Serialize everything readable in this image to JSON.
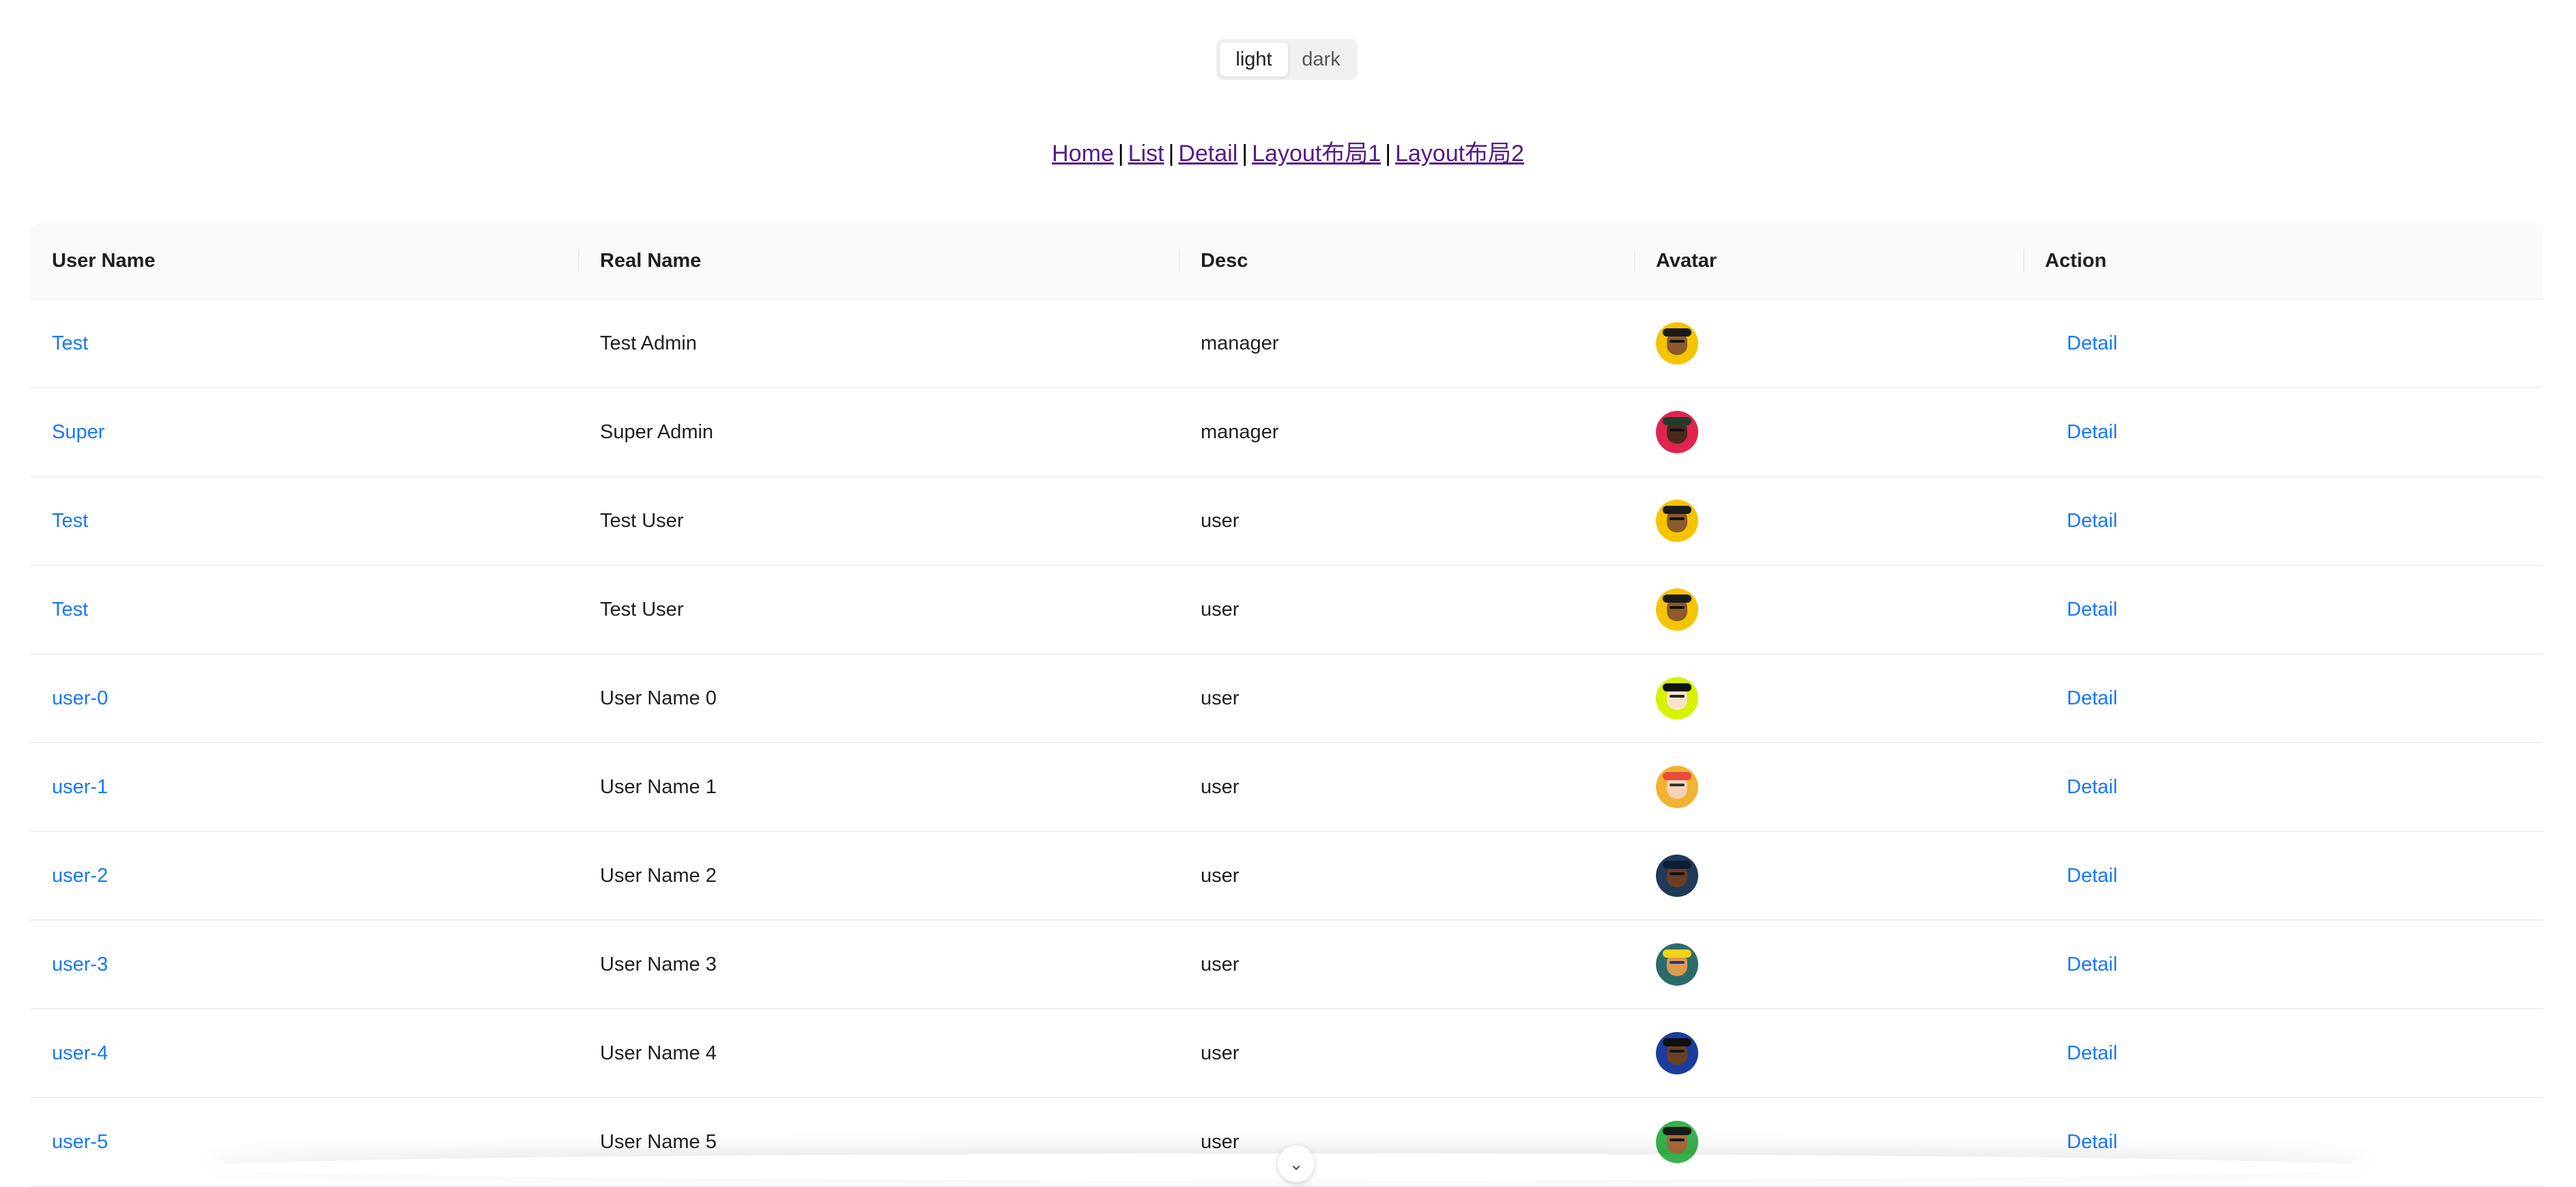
{
  "theme_switch": {
    "light_label": "light",
    "dark_label": "dark",
    "selected": "light"
  },
  "nav": {
    "links": [
      "Home",
      "List",
      "Detail",
      "Layout布局1",
      "Layout布局2"
    ],
    "separator": "|"
  },
  "table": {
    "columns": [
      "User Name",
      "Real Name",
      "Desc",
      "Avatar",
      "Action"
    ],
    "rows": [
      {
        "user_name": "Test",
        "real_name": "Test Admin",
        "desc": "manager",
        "avatar": "avatar-yellow-hat",
        "action": "Detail"
      },
      {
        "user_name": "Super",
        "real_name": "Super Admin",
        "desc": "manager",
        "avatar": "avatar-red",
        "action": "Detail"
      },
      {
        "user_name": "Test",
        "real_name": "Test User",
        "desc": "user",
        "avatar": "avatar-yellow-hat",
        "action": "Detail"
      },
      {
        "user_name": "Test",
        "real_name": "Test User",
        "desc": "user",
        "avatar": "avatar-yellow-hat",
        "action": "Detail"
      },
      {
        "user_name": "user-0",
        "real_name": "User Name 0",
        "desc": "user",
        "avatar": "avatar-lime-afro",
        "action": "Detail"
      },
      {
        "user_name": "user-1",
        "real_name": "User Name 1",
        "desc": "user",
        "avatar": "avatar-orange-crown",
        "action": "Detail"
      },
      {
        "user_name": "user-2",
        "real_name": "User Name 2",
        "desc": "user",
        "avatar": "avatar-navy",
        "action": "Detail"
      },
      {
        "user_name": "user-3",
        "real_name": "User Name 3",
        "desc": "user",
        "avatar": "avatar-teal-crown",
        "action": "Detail"
      },
      {
        "user_name": "user-4",
        "real_name": "User Name 4",
        "desc": "user",
        "avatar": "avatar-blue-beard",
        "action": "Detail"
      },
      {
        "user_name": "user-5",
        "real_name": "User Name 5",
        "desc": "user",
        "avatar": "avatar-green-cap",
        "action": "Detail"
      }
    ]
  },
  "colors": {
    "link": "#1677ff",
    "visited_link": "#551a8b",
    "header_bg": "#fafafa",
    "border": "#f0f0f0"
  },
  "scroll_button_icon": "chevron-down-icon"
}
